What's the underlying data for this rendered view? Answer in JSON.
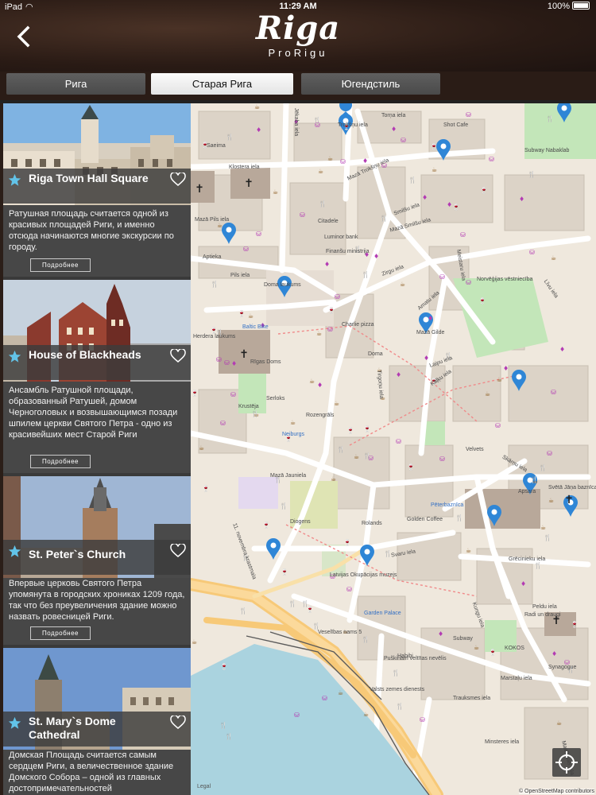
{
  "status_bar": {
    "carrier": "iPad",
    "time": "11:29 AM",
    "battery": "100%"
  },
  "header": {
    "title": "Riga",
    "subtitle": "ProRigu"
  },
  "tabs": [
    {
      "label": "Рига",
      "active": false
    },
    {
      "label": "Старая Рига",
      "active": true
    },
    {
      "label": "Югендстиль",
      "active": false
    }
  ],
  "more_label": "Подробнее",
  "cards": [
    {
      "title": "Riga Town Hall Square",
      "description": "Ратушная площадь считается одной из красивых площадей Риги, и именно отсюда начинаются многие экскурсии по городу."
    },
    {
      "title": "House of Blackheads",
      "description": "Ансамбль Ратушной площади, образованный Ратушей, домом Черноголовых и возвышающимся позади шпилем церкви Святого Петра - одно из красивейших мест Старой Риги"
    },
    {
      "title": "St. Peter`s Church",
      "description": "Впервые церковь Святого Петра упомянута в городских хрониках 1209 года, так что без преувеличения здание можно назвать ровесницей Риги."
    },
    {
      "title": "St. Mary`s Dome Cathedral",
      "description": "Домская Площадь считается самым сердцем Риги, а величественное здание Домского Собора – одной из главных достопримечательностей"
    }
  ],
  "map": {
    "labels": [
      {
        "text": "Torņa iela",
        "blue": false
      },
      {
        "text": "Trokšņu iela",
        "blue": false
      },
      {
        "text": "Shot Cafe",
        "blue": false
      },
      {
        "text": "Saeima",
        "blue": false
      },
      {
        "text": "Klostera iela",
        "blue": false
      },
      {
        "text": "Mazā Trokšņu iela",
        "blue": false
      },
      {
        "text": "Subway Nabaklab",
        "blue": false
      },
      {
        "text": "Mazā Pils iela",
        "blue": false
      },
      {
        "text": "Smilšu iela",
        "blue": false
      },
      {
        "text": "Mazā Smilšu iela",
        "blue": false
      },
      {
        "text": "Citadele",
        "blue": false
      },
      {
        "text": "Luminor bank",
        "blue": false
      },
      {
        "text": "Finanšu ministrija",
        "blue": false
      },
      {
        "text": "Pils iela",
        "blue": false
      },
      {
        "text": "Jēkaba iela",
        "blue": false
      },
      {
        "text": "Aptieka",
        "blue": false
      },
      {
        "text": "Zirgu iela",
        "blue": false
      },
      {
        "text": "Doma laukums",
        "blue": false
      },
      {
        "text": "Baltic Bike",
        "blue": true
      },
      {
        "text": "Rīgas Doms",
        "blue": false
      },
      {
        "text": "Herdera laukums",
        "blue": false
      },
      {
        "text": "Charlie pizza",
        "blue": false
      },
      {
        "text": "Amatu iela",
        "blue": false
      },
      {
        "text": "Mazā Gilde",
        "blue": false
      },
      {
        "text": "Meistaru iela",
        "blue": false
      },
      {
        "text": "Līvu iela",
        "blue": false
      },
      {
        "text": "Norvēģijas vēstniecība",
        "blue": false
      },
      {
        "text": "Kaļķu iela",
        "blue": false
      },
      {
        "text": "Laipu iela",
        "blue": false
      },
      {
        "text": "Doma",
        "blue": false
      },
      {
        "text": "Krustēja",
        "blue": false
      },
      {
        "text": "Serloks",
        "blue": false
      },
      {
        "text": "Rozengrāls",
        "blue": false
      },
      {
        "text": "Neiburgs",
        "blue": true
      },
      {
        "text": "Tirgoņu iela",
        "blue": false
      },
      {
        "text": "Velvets",
        "blue": false
      },
      {
        "text": "Skārņu iela",
        "blue": false
      },
      {
        "text": "Apsara",
        "blue": false
      },
      {
        "text": "Mazā Jaunielа",
        "blue": false
      },
      {
        "text": "Pēterbaznīca",
        "blue": true
      },
      {
        "text": "Svētā Jāņa baznīca",
        "blue": false
      },
      {
        "text": "Diogens",
        "blue": false
      },
      {
        "text": "Rolands",
        "blue": false
      },
      {
        "text": "Golden Coffee",
        "blue": false
      },
      {
        "text": "Grēcinieku iela",
        "blue": false
      },
      {
        "text": "Svaru iela",
        "blue": false
      },
      {
        "text": "Latvijas Okupācijas muzejs",
        "blue": false
      },
      {
        "text": "Garden Palace",
        "blue": true
      },
      {
        "text": "11. novembra krastmala",
        "blue": false
      },
      {
        "text": "Kungu iela",
        "blue": false
      },
      {
        "text": "Radi un draugi",
        "blue": false
      },
      {
        "text": "Veselības nams 5",
        "blue": false
      },
      {
        "text": "Puškinam veltītas nevēlis",
        "blue": false
      },
      {
        "text": "Habibi",
        "blue": false
      },
      {
        "text": "Valsts zemes dienests",
        "blue": false
      },
      {
        "text": "Subway",
        "blue": false
      },
      {
        "text": "Trauksmes iela",
        "blue": false
      },
      {
        "text": "KOKOS",
        "blue": false
      },
      {
        "text": "Synagogue",
        "blue": false
      },
      {
        "text": "Minsteres iela",
        "blue": false
      },
      {
        "text": "Maskavas iela",
        "blue": false
      },
      {
        "text": "Peldu iela",
        "blue": false
      },
      {
        "text": "Marstaļu iela",
        "blue": false
      }
    ],
    "legal": "Legal",
    "attribution": "© OpenStreetMap contributors"
  }
}
